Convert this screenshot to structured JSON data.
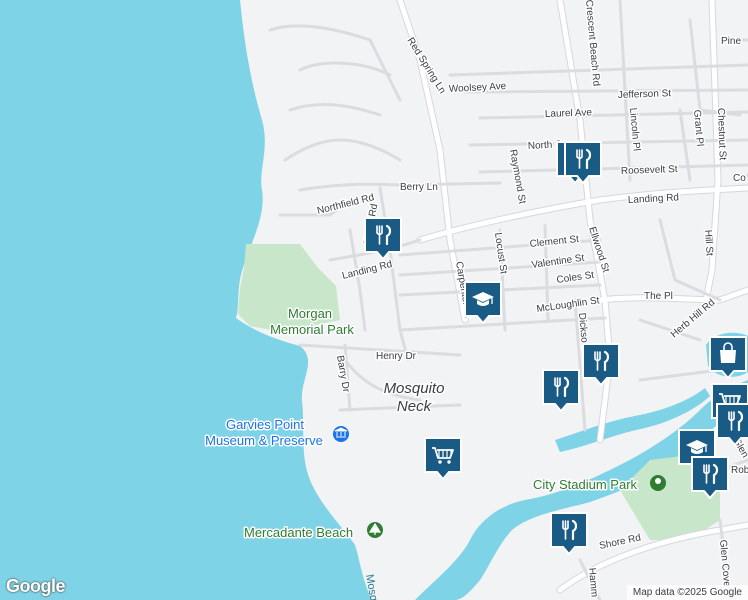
{
  "colors": {
    "water": "#7ed3e6",
    "land": "#f1f3f4",
    "park": "#c8e6c9",
    "road": "#ffffff",
    "road_casing": "#d5d8dc",
    "marker_fill": "#1a5b86",
    "marker_icon": "#ffffff",
    "poi_text": "#1a73e8",
    "park_text": "#2e7d32"
  },
  "area_labels": {
    "mosquito_neck": [
      "Mosquito",
      "Neck"
    ]
  },
  "poi_labels": {
    "morgan_park": [
      "Morgan",
      "Memorial Park"
    ],
    "garvies": [
      "Garvies Point",
      "Museum & Preserve"
    ],
    "mercadante": "Mercadante Beach",
    "city_stadium": "City Stadium Park"
  },
  "water_labels": {
    "creek": "Mosq"
  },
  "streets": [
    "Red Spring Ln",
    "Woolsey Ave",
    "Jefferson St",
    "Laurel Ave",
    "North St",
    "Roosevelt St",
    "Berry Ln",
    "Northfield Rd",
    "Shore Rd",
    "Landing Rd",
    "Landing Rd",
    "Raymond St",
    "Clement St",
    "Valentine St",
    "Coles St",
    "McLoughlin St",
    "The Pl",
    "Carpenter St",
    "Locust St",
    "Ellwood St",
    "Henry Dr",
    "Barry Dr",
    "Herb Hill Rd",
    "Shore Rd",
    "Crescent Beach Rd",
    "Lincoln Pl",
    "Grant Pl",
    "Chestnut St",
    "Pine",
    "Hill St",
    "Dickson",
    "Glen Cove",
    "Hamm",
    "Glen",
    "Rob",
    "Co"
  ],
  "markers": [
    {
      "type": "restaurant",
      "icon": "fork-knife"
    },
    {
      "type": "restaurant",
      "icon": "fork-knife"
    },
    {
      "type": "restaurant",
      "icon": "fork-knife"
    },
    {
      "type": "school",
      "icon": "graduation-cap"
    },
    {
      "type": "restaurant",
      "icon": "fork-knife"
    },
    {
      "type": "restaurant",
      "icon": "fork-knife"
    },
    {
      "type": "grocery",
      "icon": "shopping-cart"
    },
    {
      "type": "shopping",
      "icon": "shopping-bag"
    },
    {
      "type": "grocery",
      "icon": "shopping-cart"
    },
    {
      "type": "school",
      "icon": "graduation-cap"
    },
    {
      "type": "restaurant",
      "icon": "fork-knife"
    },
    {
      "type": "restaurant",
      "icon": "fork-knife"
    },
    {
      "type": "restaurant",
      "icon": "fork-knife"
    }
  ],
  "logo": "Google",
  "attribution": "Map data ©2025 Google"
}
